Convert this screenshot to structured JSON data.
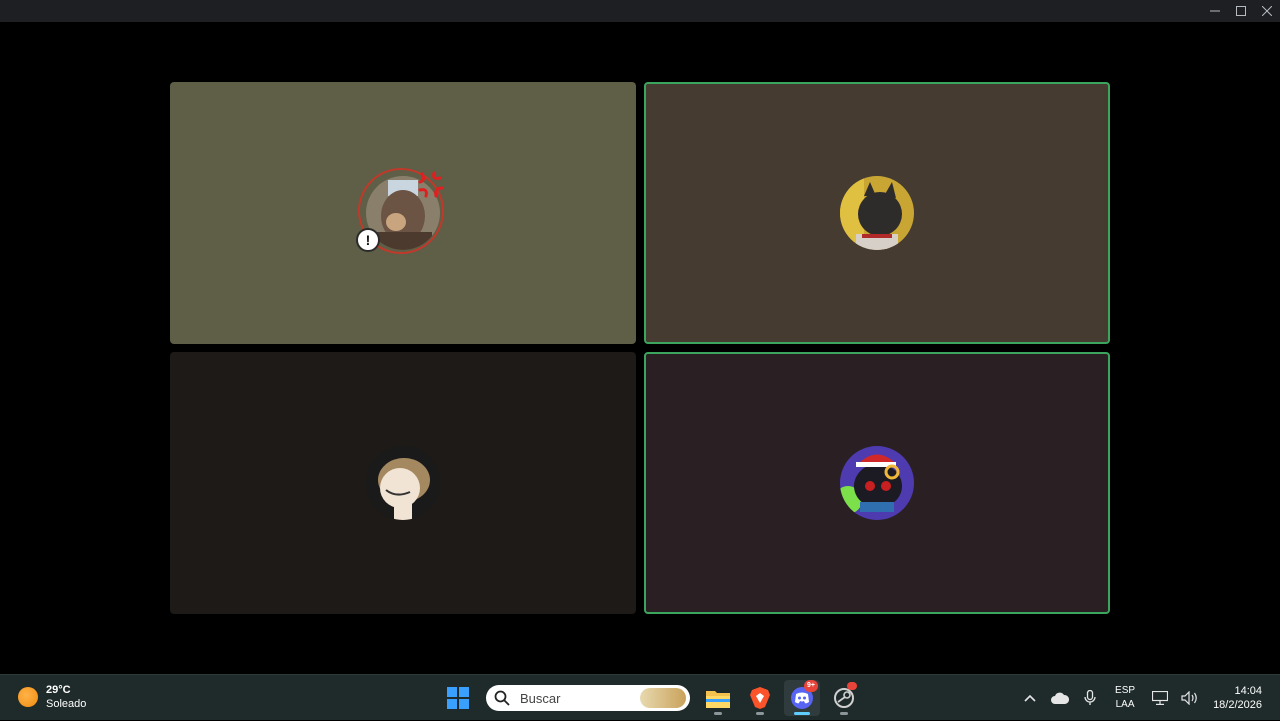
{
  "window": {
    "controls": [
      "minimize",
      "maximize",
      "close"
    ]
  },
  "call": {
    "tiles": [
      {
        "position": "top-left",
        "background": "#5f5e46",
        "speaking": false,
        "deafened": true
      },
      {
        "position": "top-right",
        "background": "#453b31",
        "speaking": true,
        "deafened": false
      },
      {
        "position": "bottom-left",
        "background": "#1d1a17",
        "speaking": false,
        "deafened": false
      },
      {
        "position": "bottom-right",
        "background": "#2a2023",
        "speaking": true,
        "deafened": false
      }
    ],
    "warning_glyph": "!",
    "speaking_color": "#3ba55d"
  },
  "taskbar": {
    "weather": {
      "temp": "29°C",
      "condition": "Soleado"
    },
    "search": {
      "placeholder": "Buscar"
    },
    "apps": [
      {
        "name": "windows-start-icon"
      },
      {
        "name": "file-explorer-icon"
      },
      {
        "name": "brave-browser-icon"
      },
      {
        "name": "discord-icon",
        "badge": "9+",
        "active": true
      },
      {
        "name": "steam-icon",
        "badge_dot": true
      }
    ],
    "tray": {
      "lang_line1": "ESP",
      "lang_line2": "LAA",
      "time": "14:04",
      "date": "18/2/2026"
    }
  }
}
